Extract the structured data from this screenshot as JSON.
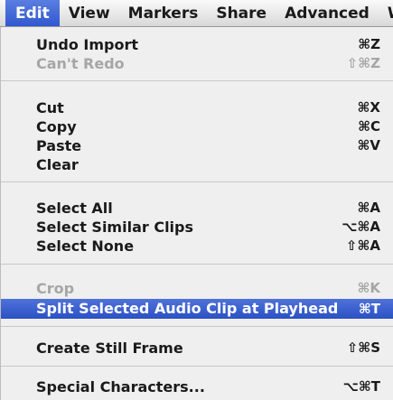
{
  "menubar": {
    "items": [
      "Edit",
      "View",
      "Markers",
      "Share",
      "Advanced",
      "W"
    ]
  },
  "menu": {
    "undo_import": {
      "label": "Undo Import",
      "shortcut": "⌘Z"
    },
    "cant_redo": {
      "label": "Can't Redo",
      "shortcut": "⇧⌘Z"
    },
    "cut": {
      "label": "Cut",
      "shortcut": "⌘X"
    },
    "copy": {
      "label": "Copy",
      "shortcut": "⌘C"
    },
    "paste": {
      "label": "Paste",
      "shortcut": "⌘V"
    },
    "clear": {
      "label": "Clear"
    },
    "select_all": {
      "label": "Select All",
      "shortcut": "⌘A"
    },
    "select_similar": {
      "label": "Select Similar Clips",
      "shortcut": "⌥⌘A"
    },
    "select_none": {
      "label": "Select None",
      "shortcut": "⇧⌘A"
    },
    "crop": {
      "label": "Crop",
      "shortcut": "⌘K"
    },
    "split_audio": {
      "label": "Split Selected Audio Clip at Playhead",
      "shortcut": "⌘T"
    },
    "create_still": {
      "label": "Create Still Frame",
      "shortcut": "⇧⌘S"
    },
    "special_chars": {
      "label": "Special Characters...",
      "shortcut": "⌥⌘T"
    }
  }
}
